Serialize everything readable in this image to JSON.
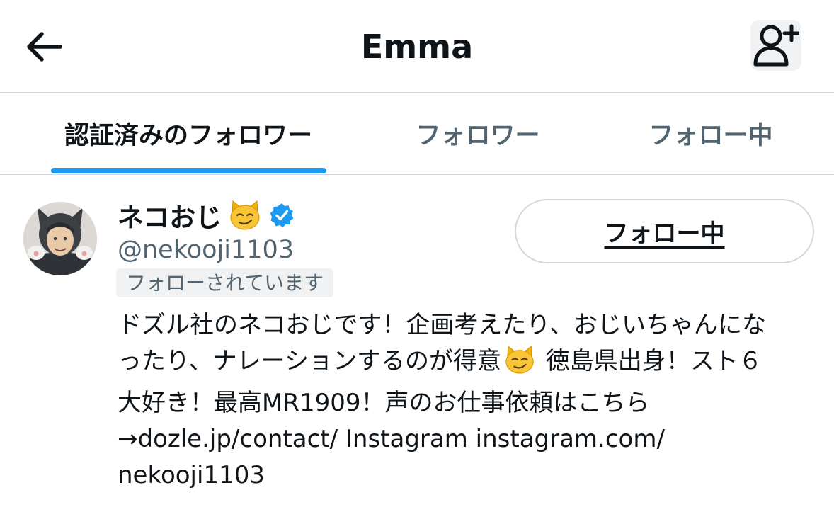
{
  "header": {
    "title": "Emma",
    "back_icon": "back-arrow-icon",
    "add_user_icon": "add-user-icon"
  },
  "tabs": [
    {
      "label": "認証済みのフォロワー",
      "active": true
    },
    {
      "label": "フォロワー",
      "active": false
    },
    {
      "label": "フォロー中",
      "active": false
    }
  ],
  "user": {
    "name": "ネコおじ",
    "name_emoji": "smirking-cat-emoji",
    "verified_icon": "verified-badge-icon",
    "handle": "@nekooji1103",
    "follows_you": "フォローされています",
    "follow_button": "フォロー中",
    "bio": {
      "line1": "ドズル社のネコおじです！企画考えたり、おじいちゃんにな",
      "line2a": "ったり、ナレーションするのが得意",
      "line2b": " 徳島県出身！スト６",
      "line3": "大好き！最高MR1909！声のお仕事依頼はこちら",
      "line4": "→dozle.jp/contact/ Instagram instagram.com/",
      "line5": "nekooji1103"
    }
  },
  "colors": {
    "accent": "#1d9bf0",
    "text_primary": "#0f1419",
    "text_secondary": "#536471",
    "border": "#cfd9de"
  }
}
